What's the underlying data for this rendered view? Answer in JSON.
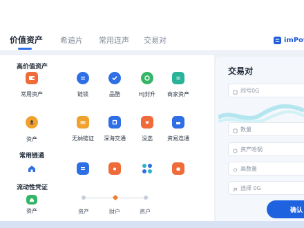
{
  "tabs": [
    {
      "label": "价值资产"
    },
    {
      "label": "希追片"
    },
    {
      "label": "常用连声"
    },
    {
      "label": "交易对"
    }
  ],
  "brand": {
    "label": "imPot",
    "icon": "brand-logo-icon"
  },
  "sections": {
    "high_value": "高价值资产",
    "common_chain": "常用链通",
    "liquidity": "流动性凭证"
  },
  "grid": [
    {
      "label": "常用资产",
      "icon": "wallet-icon",
      "color": "#f06b3a"
    },
    {
      "label": "链锁",
      "icon": "chain-icon",
      "color": "#2f6fe6"
    },
    {
      "label": "品酷",
      "icon": "check-badge-icon",
      "color": "#2f6fe6"
    },
    {
      "label": "HJ封升",
      "icon": "chat-icon",
      "color": "#35b567"
    },
    {
      "label": "商家资产",
      "icon": "document-icon",
      "color": "#2bb39a"
    },
    {
      "label": "资产",
      "icon": "person-icon",
      "color": "#f0a22e"
    },
    {
      "label": "无纳链证",
      "icon": "folder-icon",
      "color": "#f0a22e"
    },
    {
      "label": "深海交通",
      "icon": "frame-icon",
      "color": "#2f6fe6"
    },
    {
      "label": "没选",
      "icon": "box-icon",
      "color": "#f06b3a"
    },
    {
      "label": "资易连通",
      "icon": "calendar-icon",
      "color": "#2f6fe6"
    },
    {
      "label": "",
      "icon": "home-icon",
      "color": "#2f6fe6"
    },
    {
      "label": "",
      "icon": "card-icon",
      "color": "#2f6fe6"
    },
    {
      "label": "",
      "icon": "camera-icon",
      "color": "#f06b3a"
    },
    {
      "label": "",
      "icon": "apps-icon",
      "color": "#2bb3c9"
    },
    {
      "label": "",
      "icon": "bag-icon",
      "color": "#f06b3a"
    },
    {
      "label": "资产",
      "icon": "home-green-icon",
      "color": "#35b567"
    }
  ],
  "steps": [
    {
      "label": "资产"
    },
    {
      "label": "财户"
    },
    {
      "label": "资户"
    }
  ],
  "side": {
    "title": "交易对",
    "fields": [
      {
        "label": "间亏0G",
        "icon": "tag-icon"
      },
      {
        "label": "数量",
        "icon": "tag-icon"
      },
      {
        "label": "资产哈锅",
        "icon": "coin-icon"
      },
      {
        "label": "高数量",
        "icon": "pin-icon"
      },
      {
        "label": "选择 0G",
        "icon": "flag-icon"
      }
    ],
    "confirm": "确认"
  }
}
